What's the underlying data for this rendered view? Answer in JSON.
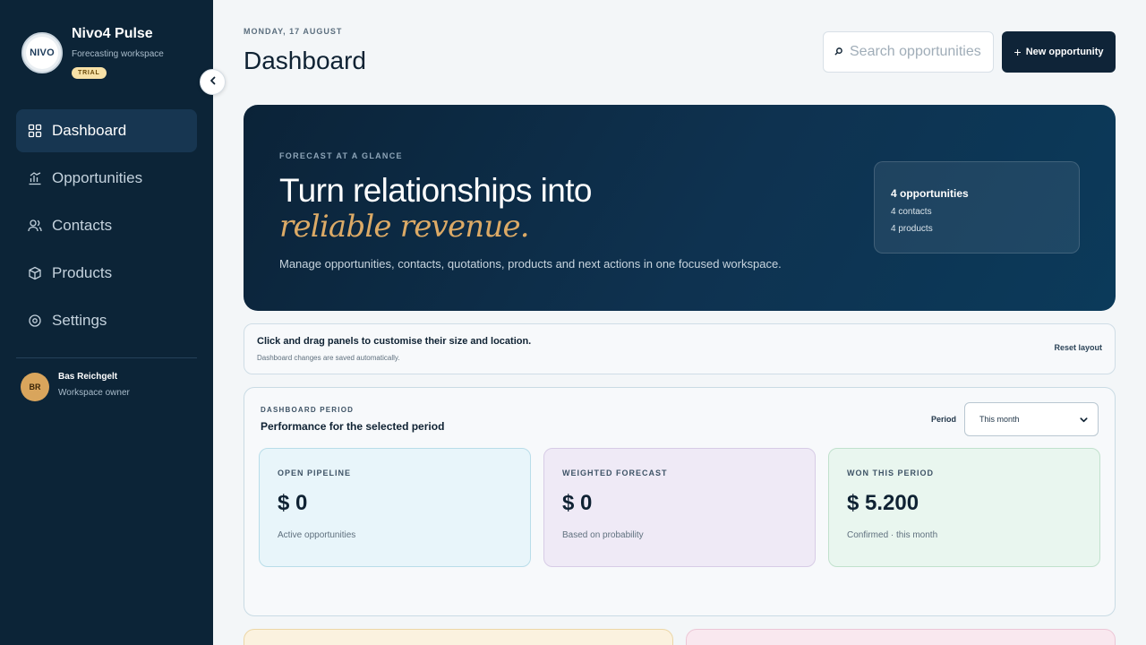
{
  "brand": {
    "logo_text": "NIVO",
    "name": "Nivo4 Pulse",
    "subtitle": "Forecasting workspace",
    "badge": "TRIAL"
  },
  "sidebar": {
    "items": [
      {
        "label": "Dashboard",
        "icon": "grid-icon",
        "active": true
      },
      {
        "label": "Opportunities",
        "icon": "chart-icon",
        "active": false
      },
      {
        "label": "Contacts",
        "icon": "users-icon",
        "active": false
      },
      {
        "label": "Products",
        "icon": "box-icon",
        "active": false
      },
      {
        "label": "Settings",
        "icon": "gear-icon",
        "active": false
      }
    ]
  },
  "user": {
    "initials": "BR",
    "name": "Bas Reichgelt",
    "role": "Workspace owner"
  },
  "header": {
    "date": "MONDAY, 17 AUGUST",
    "title": "Dashboard",
    "search_placeholder": "Search opportunities",
    "new_button": "New opportunity"
  },
  "hero": {
    "eyebrow": "FORECAST AT A GLANCE",
    "title": "Turn relationships into",
    "accent": "reliable revenue.",
    "description": "Manage opportunities, contacts, quotations, products and next actions in one focused workspace.",
    "stats": {
      "main": "4 opportunities",
      "contacts": "4 contacts",
      "products": "4 products"
    }
  },
  "infobar": {
    "title": "Click and drag panels to customise their size and location.",
    "subtitle": "Dashboard changes are saved automatically.",
    "reset": "Reset layout"
  },
  "period_panel": {
    "eyebrow": "DASHBOARD PERIOD",
    "title": "Performance for the selected period",
    "period_label": "Period",
    "period_value": "This month",
    "cards": [
      {
        "label": "OPEN PIPELINE",
        "value": "$ 0",
        "sub": "Active opportunities"
      },
      {
        "label": "WEIGHTED FORECAST",
        "value": "$ 0",
        "sub": "Based on probability"
      },
      {
        "label": "WON THIS PERIOD",
        "value": "$ 5.200",
        "sub": "Confirmed · this month"
      }
    ]
  },
  "colors": {
    "sidebar_bg": "#0c2437",
    "accent_gold": "#dcaa66",
    "primary_dark": "#0f2438"
  }
}
